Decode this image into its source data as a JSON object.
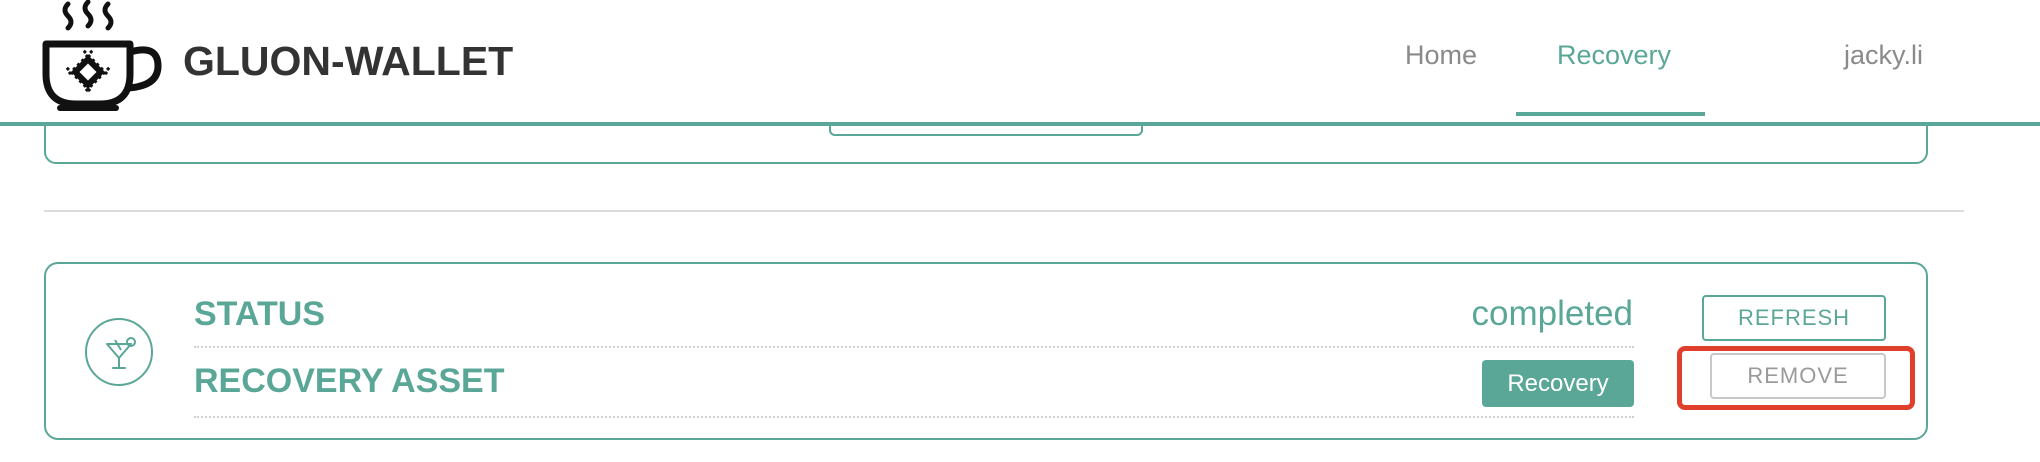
{
  "app": {
    "brand_name": "GLUON-WALLET",
    "logo_icon": "coffee-cup-chip-logo"
  },
  "nav": {
    "home_label": "Home",
    "recovery_label": "Recovery",
    "active_tab": "Recovery",
    "user_name": "jacky.li"
  },
  "card": {
    "icon": "cocktail-icon",
    "status_label": "STATUS",
    "status_value": "completed",
    "asset_label": "RECOVERY ASSET",
    "recovery_button_label": "Recovery",
    "refresh_button_label": "REFRESH",
    "remove_button_label": "REMOVE"
  },
  "colors": {
    "accent": "#5ba797",
    "highlight": "#e0402b",
    "text_dark": "#333333",
    "text_muted": "#8a8a8a"
  }
}
